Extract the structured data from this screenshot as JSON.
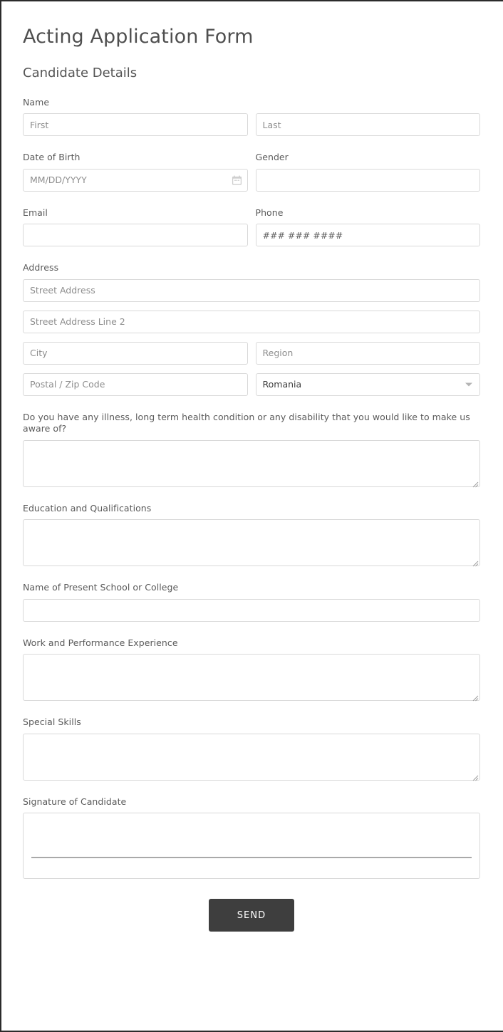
{
  "form": {
    "title": "Acting Application Form",
    "subtitle": "Candidate Details"
  },
  "fields": {
    "name": {
      "label": "Name",
      "first_placeholder": "First",
      "first_value": "",
      "last_placeholder": "Last",
      "last_value": ""
    },
    "dob": {
      "label": "Date of Birth",
      "placeholder": "MM/DD/YYYY",
      "value": "",
      "icon": "calendar-icon"
    },
    "gender": {
      "label": "Gender",
      "placeholder": "",
      "value": ""
    },
    "email": {
      "label": "Email",
      "placeholder": "",
      "value": ""
    },
    "phone": {
      "label": "Phone",
      "placeholder": "### ### ####",
      "value": ""
    },
    "address": {
      "label": "Address",
      "street_placeholder": "Street Address",
      "street_value": "",
      "street2_placeholder": "Street Address Line 2",
      "street2_value": "",
      "city_placeholder": "City",
      "city_value": "",
      "region_placeholder": "Region",
      "region_value": "",
      "postal_placeholder": "Postal / Zip Code",
      "postal_value": "",
      "country_value": "Romania",
      "country_icon": "chevron-down-icon"
    },
    "health": {
      "label": "Do you have any illness, long term health condition or any disability that you would like to make us aware of?",
      "value": ""
    },
    "education": {
      "label": "Education and Qualifications",
      "value": ""
    },
    "school": {
      "label": "Name of Present School or College",
      "value": ""
    },
    "work": {
      "label": "Work and Performance Experience",
      "value": ""
    },
    "skills": {
      "label": "Special Skills",
      "value": ""
    },
    "signature": {
      "label": "Signature of Candidate",
      "value": ""
    }
  },
  "actions": {
    "send_label": "SEND"
  },
  "colors": {
    "button_bg": "#3e3e3e",
    "button_text": "#ffffff",
    "input_border": "#d9d9d9",
    "label_text": "#5a5a5a",
    "title_text": "#4f4f4f",
    "placeholder_text": "#8d8d8d",
    "page_border": "#2b2b2b",
    "signature_line": "#a9a9a9"
  }
}
